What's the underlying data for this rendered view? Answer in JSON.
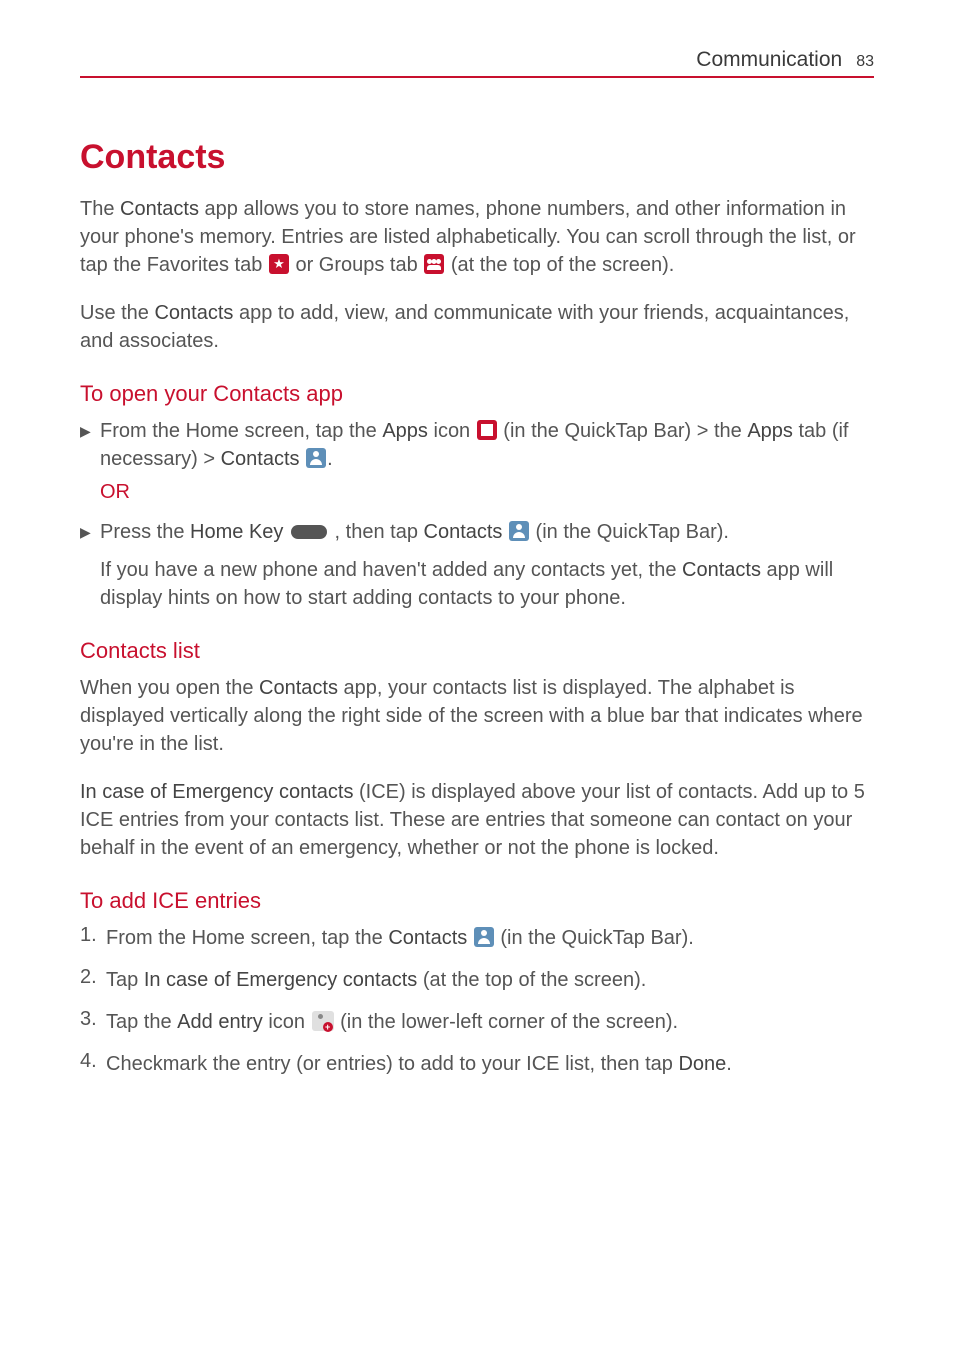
{
  "header": {
    "section": "Communication",
    "page_number": "83"
  },
  "title": "Contacts",
  "intro": {
    "p1_a": "The ",
    "p1_bold1": "Contacts",
    "p1_b": " app allows you to store names, phone numbers, and other information in your phone's memory. Entries are listed alphabetically. You can scroll through the list, or tap the Favorites tab ",
    "p1_c": " or Groups tab ",
    "p1_d": " (at the top of the screen).",
    "p2_a": "Use the ",
    "p2_bold1": "Contacts",
    "p2_b": " app to add, view, and communicate with your friends, acquaintances, and associates."
  },
  "open_section": {
    "heading": "To open your Contacts app",
    "b1_a": "From the Home screen, tap the ",
    "b1_bold1": "Apps",
    "b1_b": " icon ",
    "b1_c": " (in the QuickTap Bar) > the ",
    "b1_bold2": "Apps",
    "b1_d": " tab (if necessary) > ",
    "b1_bold3": "Contacts",
    "b1_e": " .",
    "or": "OR",
    "b2_a": "Press the ",
    "b2_bold1": "Home Key",
    "b2_b": " , then tap ",
    "b2_bold2": "Contacts",
    "b2_c": " (in the QuickTap Bar).",
    "follow_a": "If you have a new phone and haven't added any contacts yet, the ",
    "follow_bold": "Contacts",
    "follow_b": " app will display hints on how to start adding contacts to your phone."
  },
  "list_section": {
    "heading": "Contacts list",
    "p1_a": "When you open the ",
    "p1_bold1": "Contacts",
    "p1_b": " app, your contacts list is displayed. The alphabet is displayed vertically along the right side of the screen with a blue bar that indicates where you're in the list.",
    "p2_bold1": "In case of Emergency contacts",
    "p2_a": " (ICE) is displayed above your list of contacts. Add up to 5 ICE entries from your contacts list. These are entries that someone can contact on your behalf in the event of an emergency, whether or not the phone is locked."
  },
  "ice_section": {
    "heading": "To add ICE entries",
    "steps": [
      {
        "num": "1.",
        "a": "From the Home screen, tap the ",
        "bold1": "Contacts",
        "b": " ",
        "c": " (in the QuickTap Bar).",
        "icon": "contact"
      },
      {
        "num": "2.",
        "a": "Tap ",
        "bold1": "In case of Emergency contacts",
        "b": " (at the top of the screen).",
        "c": "",
        "icon": ""
      },
      {
        "num": "3.",
        "a": "Tap the ",
        "bold1": "Add entry",
        "b": " icon ",
        "c": " (in the lower-left corner of the screen).",
        "icon": "addentry"
      },
      {
        "num": "4.",
        "a": "Checkmark the entry (or entries) to add to your ICE list, then tap ",
        "bold1": "Done",
        "b": ".",
        "c": "",
        "icon": ""
      }
    ]
  }
}
